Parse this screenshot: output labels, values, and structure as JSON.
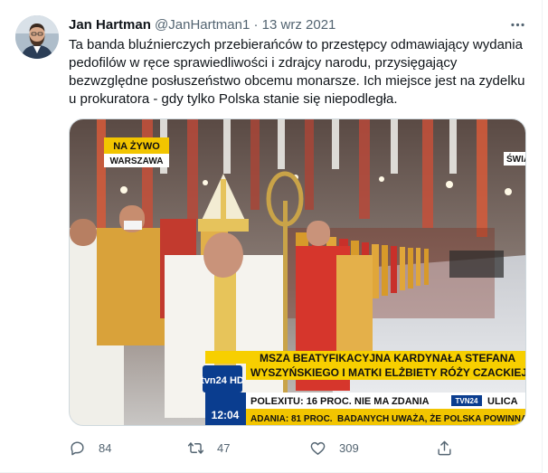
{
  "tweet": {
    "author_name": "Jan Hartman",
    "author_handle": "@JanHartman1",
    "separator": "·",
    "date": "13 wrz 2021",
    "text_lines": [
      "Ta banda bluźnierczych przebierańców to przestępcy odmawiający wydania",
      "pedofilów w ręce sprawiedliwości i zdrajcy narodu, przysięgający",
      "bezwzględne posłuszeństwo obcemu monarsze. Ich miejsce jest na zydelku",
      "u prokuratora - gdy tylko Polska stanie się niepodległa."
    ]
  },
  "media": {
    "live_badge": "NA ŻYWO",
    "location": "WARSZAWA",
    "corner_tag": "ŚWIAT",
    "headline_line1": "MSZA BEATYFIKACYJNA KARDYNAŁA STEFANA",
    "headline_line2": "WYSZYŃSKIEGO I MATKI ELŻBIETY RÓŻY CZACKIEJ",
    "channel": "tvn24 HD",
    "ticker_tag": "TVN24",
    "ticker_time": "12:04",
    "ticker_line1": "POLEXITU: 16 PROC. NIE MA ZDANIA",
    "ticker_line1_right": "ULICA",
    "ticker_line2": "BADANYCH UWAŻA, ŻE POLSKA POWINNA POZOSTAĆ",
    "ticker_line2_left": "ADANIA: 81 PROC."
  },
  "actions": {
    "reply_count": "84",
    "retweet_count": "47",
    "like_count": "309"
  },
  "icons": {
    "more": "more-icon",
    "reply": "reply-icon",
    "retweet": "retweet-icon",
    "like": "like-icon",
    "share": "share-icon"
  },
  "colors": {
    "text": "#0f1419",
    "secondary": "#536471",
    "border": "#cfd9de",
    "ticker_yellow": "#f2c500",
    "ticker_blue": "#0a3d8f"
  }
}
